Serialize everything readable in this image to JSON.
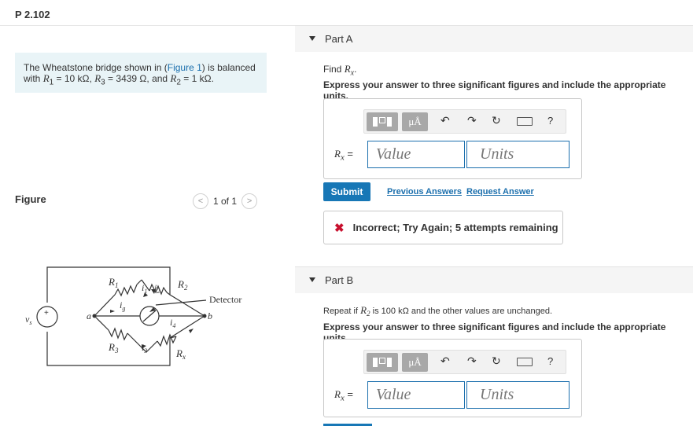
{
  "problem": {
    "title": "P 2.102"
  },
  "intro": {
    "text_pre": "The Wheatstone bridge shown in (",
    "figure_link": "Figure 1",
    "text_mid": ") is balanced",
    "line2_pre": "with ",
    "r1_sym": "R",
    "r1_sub": "1",
    "r1_val": " = 10 kΩ, ",
    "r3_sym": "R",
    "r3_sub": "3",
    "r3_val": " = 3439 Ω, and ",
    "r2_sym": "R",
    "r2_sub": "2",
    "r2_val": " = 1 kΩ."
  },
  "figure": {
    "label": "Figure",
    "pager": "1 of 1",
    "prev_glyph": "<",
    "next_glyph": ">",
    "labels": {
      "R1": "R",
      "R1_sub": "1",
      "R2": "R",
      "R2_sub": "2",
      "R3": "R",
      "R3_sub": "3",
      "Rx": "R",
      "Rx_sub": "x",
      "i1": "i",
      "i1_sub": "1",
      "i2": "i",
      "i2_sub": "2",
      "i3": "i",
      "i3_sub": "3",
      "i4": "i",
      "i4_sub": "4",
      "ig": "i",
      "ig_sub": "g",
      "vs": "v",
      "vs_sub": "s",
      "plus": "+",
      "node_a": "a",
      "node_b": "b",
      "detector": "Detector"
    }
  },
  "part_a": {
    "label": "Part A",
    "find_pre": "Find ",
    "find_sym": "R",
    "find_sub": "x",
    "find_post": ".",
    "instruction": "Express your answer to three significant figures and include the appropriate units.",
    "toolbar": {
      "mu_label": "μÅ",
      "help": "?"
    },
    "rx_label_sym": "R",
    "rx_label_sub": "x",
    "rx_label_eq": " =",
    "value_placeholder": "Value",
    "units_placeholder": "Units",
    "submit_label": "Submit",
    "previous_answers": "Previous Answers",
    "request_answer": "Request Answer",
    "feedback_icon": "✖",
    "feedback": "Incorrect; Try Again; 5 attempts remaining"
  },
  "part_b": {
    "label": "Part B",
    "repeat_pre": "Repeat if ",
    "repeat_sym": "R",
    "repeat_sub": "2",
    "repeat_post": " is 100 kΩ and the other values are unchanged.",
    "instruction": "Express your answer to three significant figures and include the appropriate units.",
    "toolbar": {
      "mu_label": "μÅ",
      "help": "?"
    },
    "rx_label_sym": "R",
    "rx_label_sub": "x",
    "rx_label_eq": " =",
    "value_placeholder": "Value",
    "units_placeholder": "Units"
  },
  "colors": {
    "accent": "#1777b6",
    "link": "#1b6fad",
    "intro_bg": "#e9f4f7",
    "error": "#c8102e"
  }
}
